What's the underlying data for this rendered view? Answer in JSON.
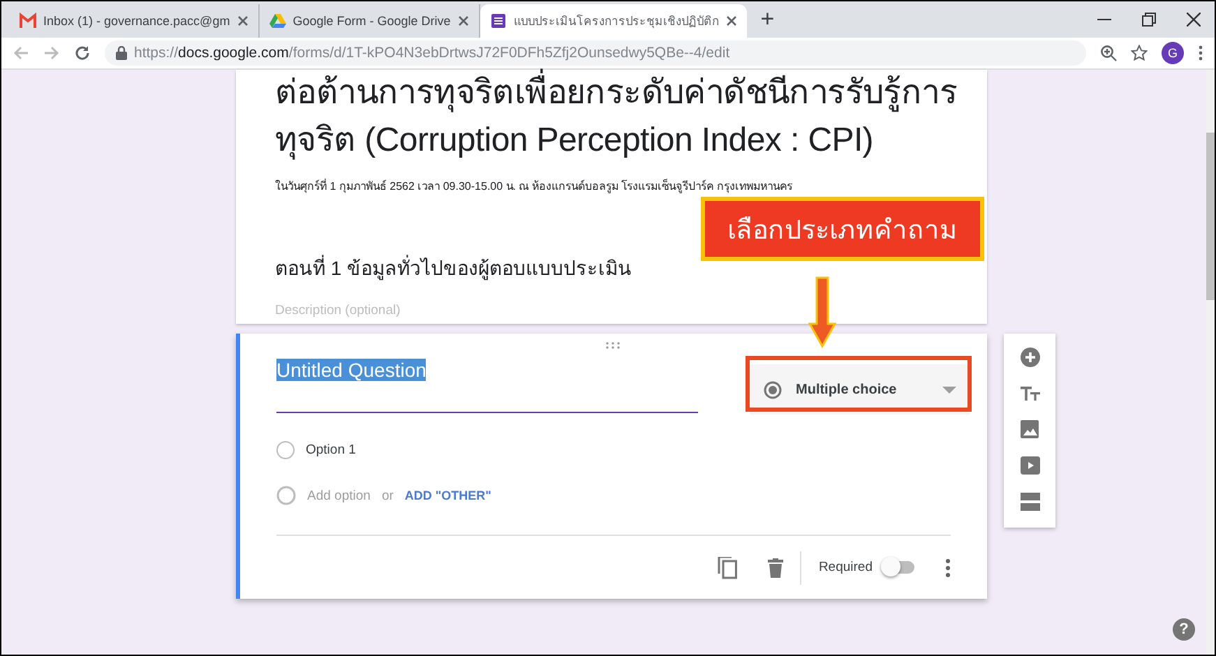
{
  "browser": {
    "tabs": [
      {
        "title": "Inbox (1) - governance.pacc@gm",
        "selected": false
      },
      {
        "title": "Google Form - Google Drive",
        "selected": false
      },
      {
        "title": "แบบประเมินโครงการประชุมเชิงปฏิบัติก",
        "selected": true
      }
    ],
    "new_tab": "+",
    "url_scheme": "https://",
    "url_host": "docs.google.com",
    "url_path": "/forms/d/1T-kPO4N3ebDrtwsJ72F0DFh5Zfj2Ounsedwy5QBe--4/edit",
    "avatar": "G"
  },
  "form": {
    "title": "ต่อต้านการทุจริตเพื่อยกระดับค่าดัชนีการรับรู้การทุจริต (Corruption Perception Index : CPI)",
    "description": "ในวันศุกร์ที่ 1 กุมภาพันธ์ 2562 เวลา 09.30-15.00 น. ณ ห้องแกรนด์บอลรูม โรงแรมเซ็นจูรีปาร์ค กรุงเทพมหานคร",
    "section": {
      "title": "ตอนที่ 1 ข้อมูลทั่วไปของผู้ตอบแบบประเมิน",
      "placeholder": "Description (optional)"
    }
  },
  "question": {
    "title": "Untitled Question",
    "type": "Multiple choice",
    "options": [
      {
        "label": "Option 1",
        "selected": false
      }
    ],
    "add_option": "Add option",
    "or": "or",
    "add_other": "ADD \"OTHER\"",
    "required_label": "Required",
    "required": false
  },
  "annotation": {
    "label": "เลือกประเภทคำถาม"
  },
  "help": "?"
}
